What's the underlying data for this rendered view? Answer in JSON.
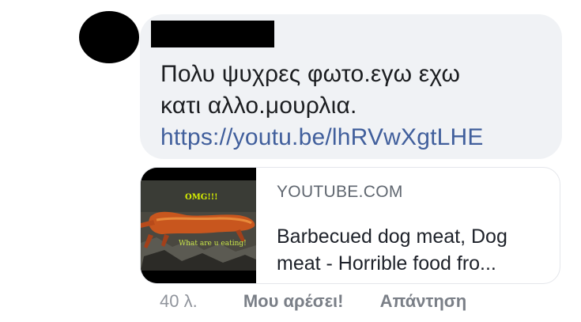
{
  "comment": {
    "author_redacted": true,
    "text_line1": "Πολυ ψυχρες φωτο.εγω εχω",
    "text_line2": "κατι αλλο.μουρλια.",
    "link": "https://youtu.be/lhRVwXgtLHE"
  },
  "preview": {
    "domain": "YOUTUBE.COM",
    "title_line1": "Barbecued dog meat, Dog",
    "title_line2": "meat - Horrible food fro...",
    "thumbnail": {
      "overlay_text_1": "OMG!!!",
      "overlay_text_2": "What are u eating!"
    }
  },
  "actions": {
    "time": "40 λ.",
    "like_label": "Μου αρέσει!",
    "reply_label": "Απάντηση"
  },
  "colors": {
    "bubble_bg": "#f0f2f5",
    "link": "#385898",
    "meta": "#90949c"
  }
}
